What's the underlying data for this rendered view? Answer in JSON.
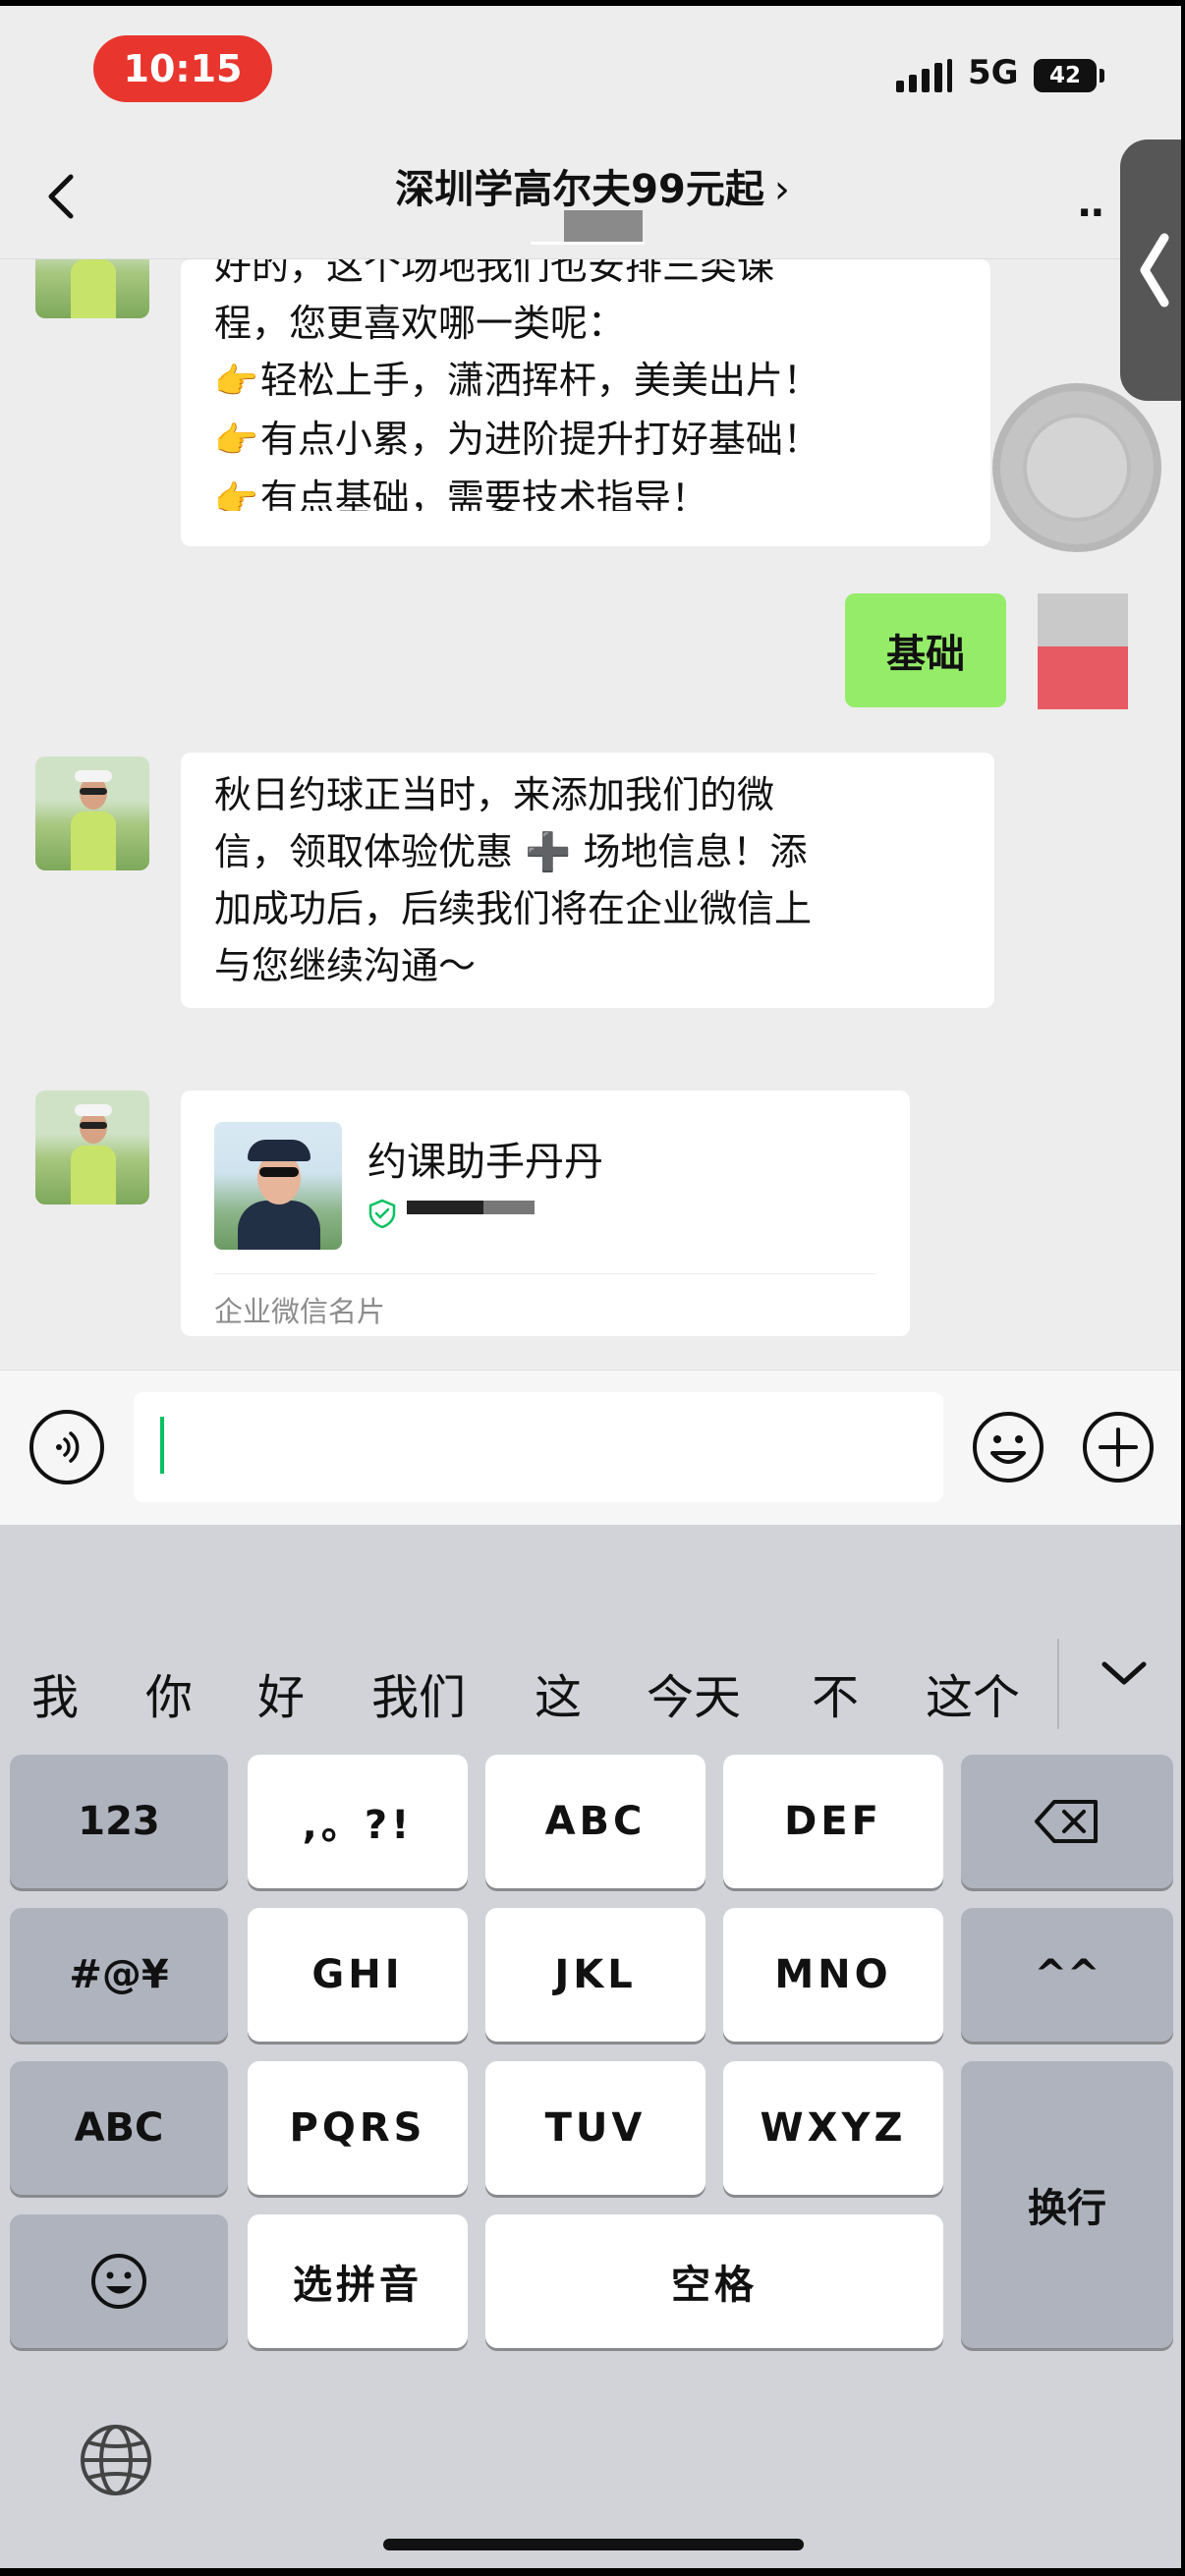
{
  "status_bar": {
    "time": "10:15",
    "network": "5G",
    "battery": "42"
  },
  "nav": {
    "title": "深圳学高尔夫99元起",
    "title_chevron": "›",
    "more": "··"
  },
  "messages": {
    "bubble1": {
      "lines": [
        "好的，这个场地我们也安排三类课",
        "程，您更喜欢哪一类呢：",
        "轻松上手，潇洒挥杆，美美出片！",
        "有点小累，为进阶提升打好基础！",
        "有点基础，需要技术指导！"
      ],
      "pointer": "👉"
    },
    "my_reply": "基础",
    "bubble3": {
      "lines": [
        "秋日约球正当时，来添加我们的微",
        "信，领取体验优惠 ➕ 场地信息！添",
        "加成功后，后续我们将在企业微信上",
        "与您继续沟通～"
      ]
    },
    "card": {
      "name": "约课助手丹丹",
      "footer": "企业微信名片"
    }
  },
  "input": {
    "value": ""
  },
  "keyboard": {
    "candidates": [
      "我",
      "你",
      "好",
      "我们",
      "这",
      "今天",
      "不",
      "这个"
    ],
    "keys": {
      "num": "123",
      "punct": ",。?!",
      "abc": "ABC",
      "def": "DEF",
      "sym": "#@¥",
      "ghi": "GHI",
      "jkl": "JKL",
      "mno": "MNO",
      "face": "^^",
      "abc_mode": "ABC",
      "pqrs": "PQRS",
      "tuv": "TUV",
      "wxyz": "WXYZ",
      "newline": "换行",
      "pinyin": "选拼音",
      "space": "空格"
    }
  },
  "colors": {
    "time_pill": "#e8362f",
    "my_bubble": "#95ec69",
    "caret": "#07c160",
    "verified": "#07c160"
  }
}
